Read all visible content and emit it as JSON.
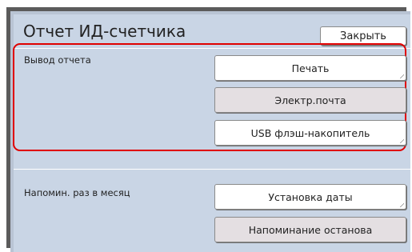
{
  "header": {
    "title": "Отчет ИД-счетчика",
    "close_label": "Закрыть"
  },
  "report_output": {
    "label": "Вывод отчета",
    "print_label": "Печать",
    "email_label": "Электр.почта",
    "usb_label": "USB флэш-накопитель"
  },
  "monthly_reminder": {
    "label": "Напомин. раз в месяц",
    "set_date_label": "Установка даты",
    "stop_reminder_label": "Напоминание останова"
  }
}
